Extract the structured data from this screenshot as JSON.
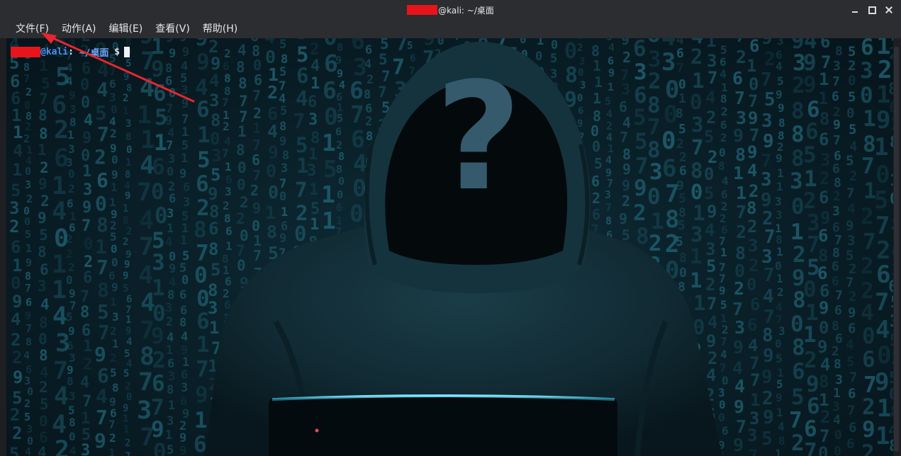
{
  "window": {
    "title_suffix": "@kali: ~/桌面",
    "controls": [
      "minimize-icon",
      "maximize-icon",
      "close-icon"
    ]
  },
  "menu": {
    "items": [
      "文件(F)",
      "动作(A)",
      "编辑(E)",
      "查看(V)",
      "帮助(H)"
    ]
  },
  "terminal": {
    "prompt_host": "@kali",
    "prompt_colon": ":",
    "prompt_path": " ~/桌面",
    "prompt_symbol": " $",
    "wallpaper_symbol": "?"
  },
  "colors": {
    "redaction": "#e8141b",
    "annotation_arrow": "#e8262d",
    "prompt_host": "#4e8ff0",
    "wallpaper_digits": "#1f5f70"
  }
}
